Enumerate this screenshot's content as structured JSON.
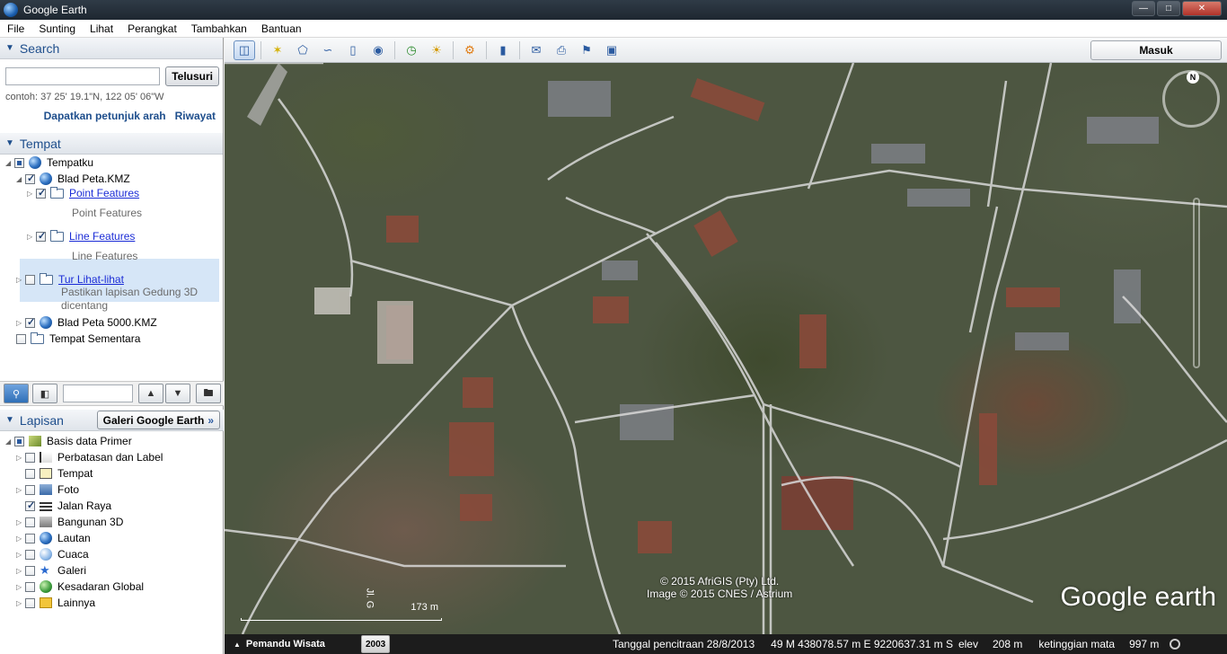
{
  "window": {
    "title": "Google Earth"
  },
  "menu": [
    "File",
    "Sunting",
    "Lihat",
    "Perangkat",
    "Tambahkan",
    "Bantuan"
  ],
  "search": {
    "header": "Search",
    "button_label": "Telusuri",
    "input_value": "",
    "example": "contoh: 37 25' 19.1\"N, 122 05' 06\"W",
    "directions_link": "Dapatkan petunjuk arah",
    "history_link": "Riwayat"
  },
  "places": {
    "header": "Tempat",
    "items": [
      {
        "label": "Tempatku",
        "checked": "partial"
      },
      {
        "label": "Blad Peta.KMZ",
        "checked": "checked"
      },
      {
        "label": "Point Features",
        "checked": "checked",
        "sub": "Point Features"
      },
      {
        "label": "Line Features",
        "checked": "checked",
        "sub": "Line Features"
      },
      {
        "label": "Tur Lihat-lihat",
        "checked": "none",
        "sub": "Pastikan lapisan Gedung 3D dicentang"
      },
      {
        "label": "Blad Peta 5000.KMZ",
        "checked": "checked"
      },
      {
        "label": "Tempat Sementara",
        "checked": "none"
      }
    ]
  },
  "layers": {
    "header": "Lapisan",
    "gallery_button": "Galeri Google Earth",
    "items": [
      {
        "label": "Basis data Primer",
        "checked": "partial"
      },
      {
        "label": "Perbatasan dan Label",
        "checked": "none"
      },
      {
        "label": "Tempat",
        "checked": "none"
      },
      {
        "label": "Foto",
        "checked": "none"
      },
      {
        "label": "Jalan Raya",
        "checked": "checked"
      },
      {
        "label": "Bangunan 3D",
        "checked": "none"
      },
      {
        "label": "Lautan",
        "checked": "none"
      },
      {
        "label": "Cuaca",
        "checked": "none"
      },
      {
        "label": "Galeri",
        "checked": "none"
      },
      {
        "label": "Kesadaran Global",
        "checked": "none"
      },
      {
        "label": "Lainnya",
        "checked": "none"
      }
    ]
  },
  "toolbar": {
    "signin_label": "Masuk"
  },
  "map": {
    "copyright_line1": "© 2015 AfriGIS (Pty) Ltd.",
    "copyright_line2": "Image © 2015 CNES / Astrium",
    "logo": "Google earth",
    "compass_north": "N",
    "scale_label": "173 m",
    "road_label": "Jl. G"
  },
  "status": {
    "tour_label": "Pemandu Wisata",
    "year": "2003",
    "imagery_date": "Tanggal pencitraan 28/8/2013",
    "coordinates": "49 M 438078.57 m E 9220637.31 m S",
    "elev_label": "elev",
    "elev_value": "208 m",
    "eye_label": "ketinggian mata",
    "eye_value": "997 m"
  },
  "colors": {
    "accent": "#1e4e8c",
    "link": "#1a2bd6"
  }
}
